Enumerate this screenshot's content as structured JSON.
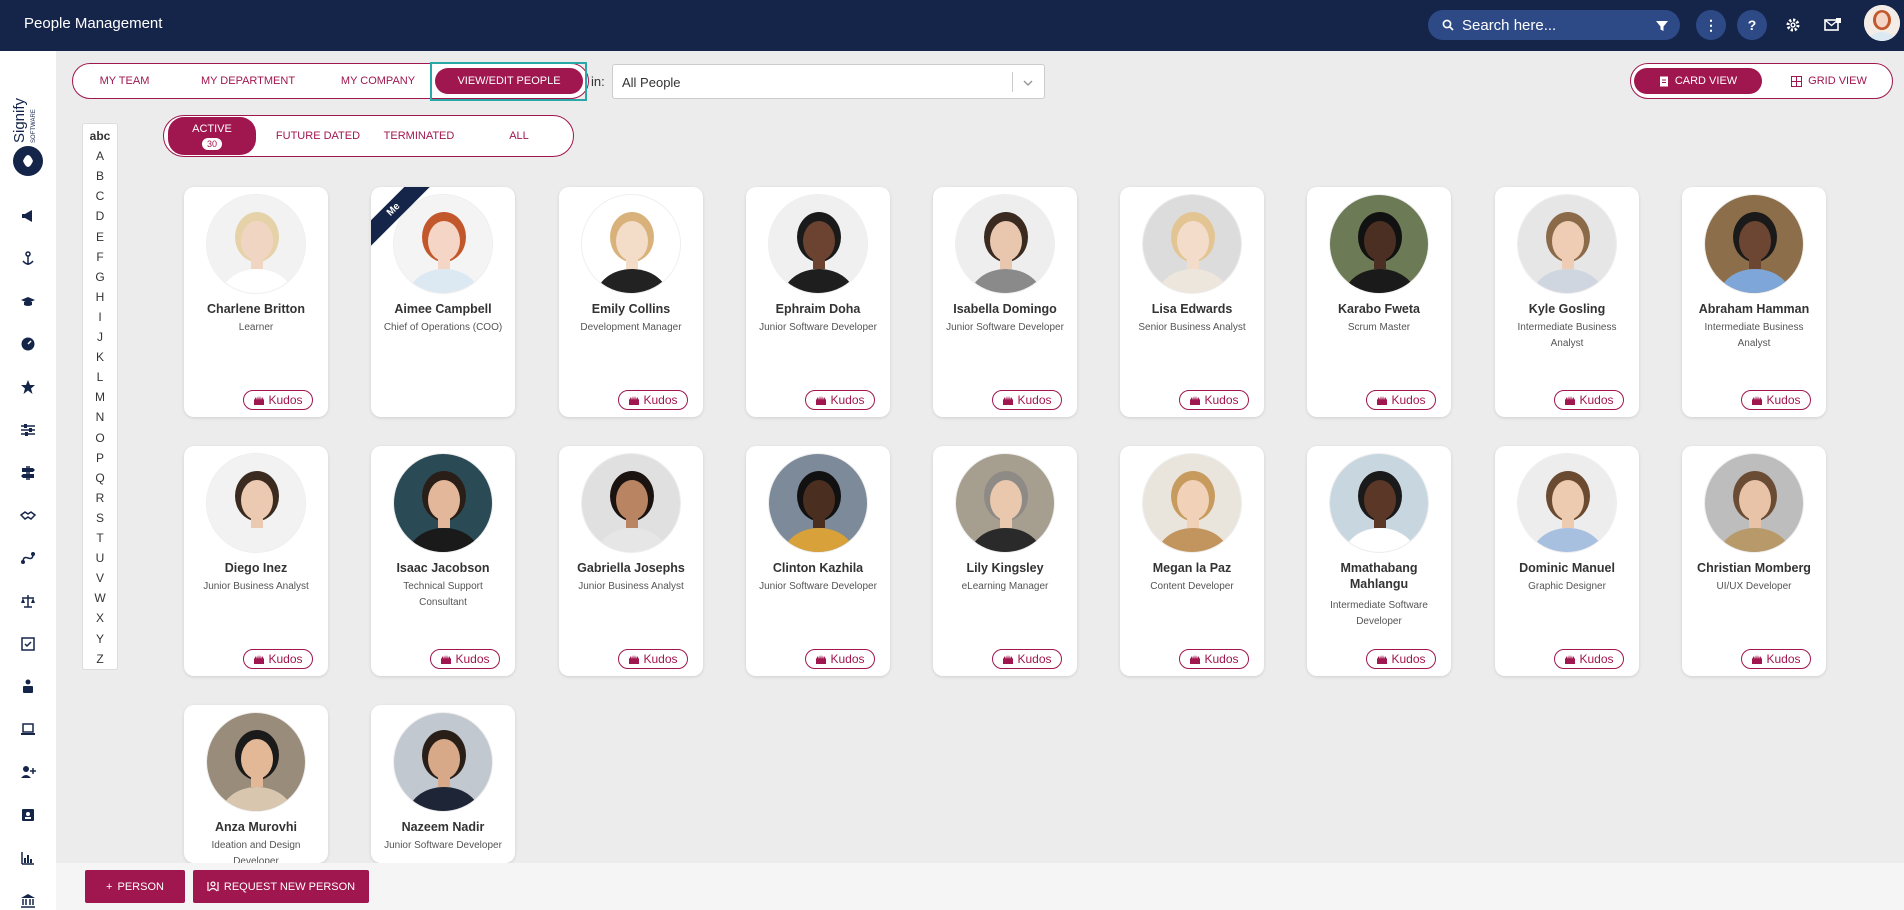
{
  "header": {
    "title": "People Management",
    "search_placeholder": "Search here...",
    "icons": [
      "search-icon",
      "filter-icon",
      "more-icon",
      "help-icon",
      "settings-icon",
      "messages-icon",
      "user-avatar"
    ]
  },
  "sidebar": {
    "logo_text": "Signify",
    "logo_subtext": "SOFTWARE",
    "icons": [
      "megaphone-icon",
      "anchor-icon",
      "graduation-cap-icon",
      "dashboard-icon",
      "star-icon",
      "sliders-icon",
      "signpost-icon",
      "handshake-icon",
      "route-icon",
      "scales-icon",
      "checklist-icon",
      "briefcase-person-icon",
      "laptop-icon",
      "user-add-icon",
      "id-card-icon",
      "bar-chart-icon",
      "bank-icon"
    ]
  },
  "tabs": [
    {
      "label": "MY TEAM",
      "active": false
    },
    {
      "label": "MY DEPARTMENT",
      "active": false
    },
    {
      "label": "MY COMPANY",
      "active": false
    },
    {
      "label": "VIEW/EDIT PEOPLE",
      "active": true
    }
  ],
  "filter": {
    "in_label": "in:",
    "value": "All People"
  },
  "views": [
    {
      "label": "CARD VIEW",
      "icon": "card-icon",
      "active": true
    },
    {
      "label": "GRID VIEW",
      "icon": "grid-icon",
      "active": false
    }
  ],
  "status_tabs": [
    {
      "label": "ACTIVE",
      "count": "30",
      "active": true
    },
    {
      "label": "FUTURE DATED",
      "active": false
    },
    {
      "label": "TERMINATED",
      "active": false
    },
    {
      "label": "ALL",
      "active": false
    }
  ],
  "alphabet": [
    "abc",
    "A",
    "B",
    "C",
    "D",
    "E",
    "F",
    "G",
    "H",
    "I",
    "J",
    "K",
    "L",
    "M",
    "N",
    "O",
    "P",
    "Q",
    "R",
    "S",
    "T",
    "U",
    "V",
    "W",
    "X",
    "Y",
    "Z"
  ],
  "kudos_label": "Kudos",
  "me_label": "Me",
  "people": [
    {
      "name": "Charlene Britton",
      "role": "Learner",
      "skin": "#f1d5c3",
      "hair": "#e6d2a8",
      "shirt": "#ffffff",
      "bg": "#f2f2f2",
      "kudos": true
    },
    {
      "name": "Aimee Campbell",
      "role": "Chief of Operations (COO)",
      "skin": "#f5d6c6",
      "hair": "#c2572b",
      "shirt": "#dce8f2",
      "bg": "#f4f4f4",
      "kudos": false,
      "me": true
    },
    {
      "name": "Emily Collins",
      "role": "Development Manager",
      "skin": "#f3dcc8",
      "hair": "#d8b27a",
      "shirt": "#222222",
      "bg": "#ffffff",
      "kudos": true
    },
    {
      "name": "Ephraim Doha",
      "role": "Junior Software Developer",
      "skin": "#6b4330",
      "hair": "#1a1a1a",
      "shirt": "#1e1e1e",
      "bg": "#f0f0f0",
      "kudos": true
    },
    {
      "name": "Isabella Domingo",
      "role": "Junior Software Developer",
      "skin": "#e8c7ae",
      "hair": "#3a2a20",
      "shirt": "#8a8a8a",
      "bg": "#eeeeee",
      "kudos": true
    },
    {
      "name": "Lisa Edwards",
      "role": "Senior Business Analyst",
      "skin": "#f4dccb",
      "hair": "#e2c592",
      "shirt": "#ede6dc",
      "bg": "#dcdcdc",
      "kudos": true
    },
    {
      "name": "Karabo Fweta",
      "role": "Scrum Master",
      "skin": "#4b2f22",
      "hair": "#111111",
      "shirt": "#1a1a1a",
      "bg": "#6c7a55",
      "kudos": true
    },
    {
      "name": "Kyle Gosling",
      "role": "Intermediate Business Analyst",
      "skin": "#efcdb4",
      "hair": "#8b6a4a",
      "shirt": "#cfd6df",
      "bg": "#e6e6e6",
      "kudos": true
    },
    {
      "name": "Abraham Hamman",
      "role": "Intermediate Business Analyst",
      "skin": "#6d4633",
      "hair": "#1a1a1a",
      "shirt": "#7fa6d8",
      "bg": "#8c6f4a",
      "kudos": true
    },
    {
      "name": "Diego Inez",
      "role": "Junior Business Analyst",
      "skin": "#eccab2",
      "hair": "#3b2a1f",
      "shirt": "#f2f2f2",
      "bg": "#f2f2f2",
      "kudos": true
    },
    {
      "name": "Isaac Jacobson",
      "role": "Technical Support Consultant",
      "skin": "#e3b79a",
      "hair": "#2a1f18",
      "shirt": "#1a1a1a",
      "bg": "#2a4a55",
      "kudos": true
    },
    {
      "name": "Gabriella Josephs",
      "role": "Junior Business Analyst",
      "skin": "#b88462",
      "hair": "#1b1310",
      "shirt": "#e6e6e6",
      "bg": "#e0e0e0",
      "kudos": true
    },
    {
      "name": "Clinton Kazhila",
      "role": "Junior Software Developer",
      "skin": "#4a2e1f",
      "hair": "#111111",
      "shirt": "#d8a13a",
      "bg": "#7d8a99",
      "kudos": true
    },
    {
      "name": "Lily Kingsley",
      "role": "eLearning Manager",
      "skin": "#e9c8ae",
      "hair": "#8e8a86",
      "shirt": "#2a2a2a",
      "bg": "#a69e8e",
      "kudos": true
    },
    {
      "name": "Megan la Paz",
      "role": "Content Developer",
      "skin": "#f1d1b8",
      "hair": "#c79b5d",
      "shirt": "#c2955e",
      "bg": "#e9e4dc",
      "kudos": true
    },
    {
      "name": "Mmathabang Mahlangu",
      "role": "Intermediate Software Developer",
      "skin": "#5b3727",
      "hair": "#1a1a1a",
      "shirt": "#ffffff",
      "bg": "#c8d6df",
      "kudos": true
    },
    {
      "name": "Dominic Manuel",
      "role": "Graphic Designer",
      "skin": "#eccbb0",
      "hair": "#6a4a30",
      "shirt": "#a7c0e0",
      "bg": "#ededed",
      "kudos": true
    },
    {
      "name": "Christian Momberg",
      "role": "UI/UX Developer",
      "skin": "#e9c3a8",
      "hair": "#6a4c35",
      "shirt": "#b7996a",
      "bg": "#bdbdbd",
      "kudos": true
    },
    {
      "name": "Anza Murovhi",
      "role": "Ideation and Design Developer",
      "skin": "#e2b896",
      "hair": "#1a1a1a",
      "shirt": "#d9c6ae",
      "bg": "#9a8c7a",
      "kudos": false
    },
    {
      "name": "Nazeem Nadir",
      "role": "Junior Software Developer",
      "skin": "#d7a989",
      "hair": "#2a1f18",
      "shirt": "#1d2536",
      "bg": "#c2c8cf",
      "kudos": false
    }
  ],
  "actions": {
    "add_person": "PERSON",
    "request_new_person": "REQUEST NEW PERSON"
  },
  "colors": {
    "brand": "#a0164e",
    "navy": "#15254a",
    "highlight": "#2aa8a8"
  }
}
